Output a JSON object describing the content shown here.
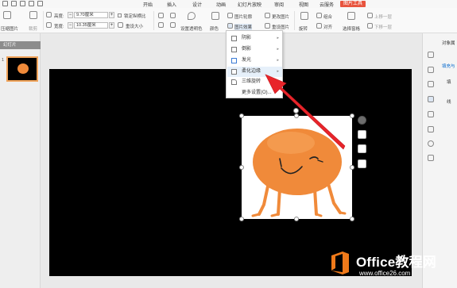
{
  "menu": {
    "items": [
      "开始",
      "插入",
      "设计",
      "动画",
      "幻灯片放映",
      "审阅",
      "视图",
      "云服务"
    ],
    "active": "图片工具"
  },
  "ribbon": {
    "compress_label": "压缩图片",
    "crop_label": "裁剪",
    "height_label": "高度:",
    "height_value": "9.70厘米",
    "width_label": "宽度:",
    "width_value": "10.35厘米",
    "lock_ratio_label": "锁定纵横比",
    "reset_size_label": "重设大小",
    "set_transparent_label": "设置透明色",
    "color_label": "颜色",
    "picture_outline_label": "图片轮廓",
    "change_picture_label": "更改图片",
    "picture_effects_label": "图片效果",
    "reset_picture_label": "重设图片",
    "combine_label": "组合",
    "rotate_label": "旋转",
    "align_label": "对齐",
    "selection_pane_label": "选择窗格",
    "bring_forward_label": "上移一层",
    "send_backward_label": "下移一层"
  },
  "left_panel": {
    "tab_label": "幻灯片",
    "slide_number": "1"
  },
  "right_panel": {
    "title": "对象属",
    "fill_label": "填充与",
    "fill_short": "填",
    "line_short": "线"
  },
  "dropdown": {
    "items": [
      {
        "label": "阴影",
        "has_submenu": true
      },
      {
        "label": "倒影",
        "has_submenu": true
      },
      {
        "label": "发光",
        "has_submenu": true
      },
      {
        "label": "柔化边缘",
        "has_submenu": true
      },
      {
        "label": "三维旋转",
        "has_submenu": true
      },
      {
        "label": "更多设置(O)...",
        "has_submenu": false
      }
    ],
    "hovered_index": 3
  },
  "watermark": {
    "brand": "Office教程网",
    "url": "www.office26.com"
  },
  "colors": {
    "accent": "#e8543e",
    "arrow": "#e8242a",
    "orange_character": "#f08a3a",
    "watermark_orange": "#f07a1a"
  }
}
